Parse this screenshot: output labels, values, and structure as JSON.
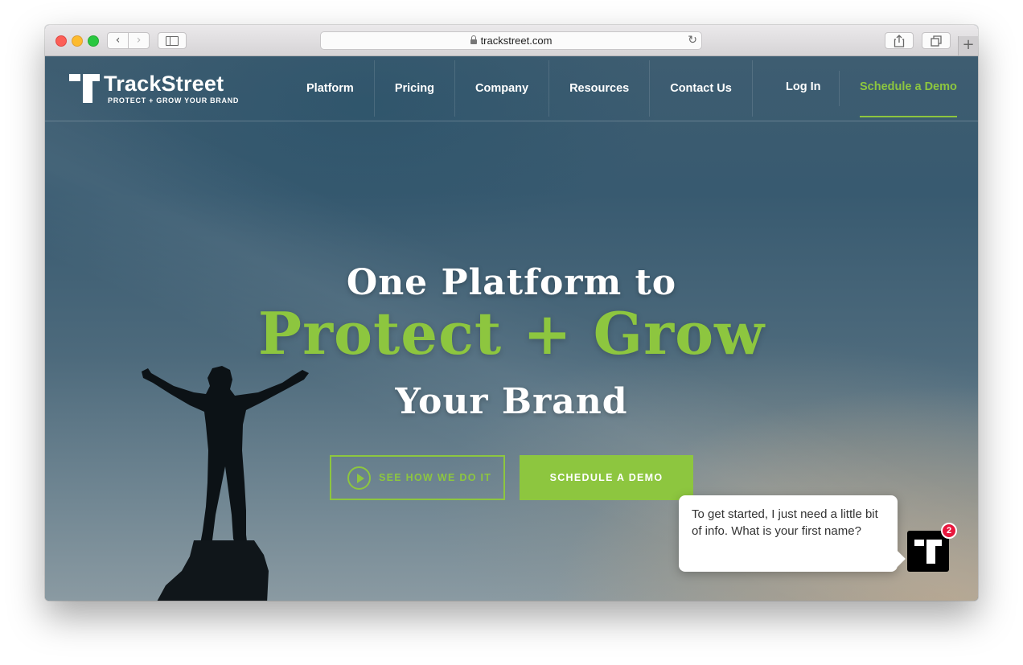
{
  "browser": {
    "url": "trackstreet.com",
    "nav_back": "‹",
    "nav_forward": "›",
    "reload": "↻",
    "new_tab": "+"
  },
  "site": {
    "logo": {
      "name": "TrackStreet",
      "tagline": "PROTECT + GROW YOUR BRAND"
    },
    "nav": {
      "items": [
        {
          "label": "Platform"
        },
        {
          "label": "Pricing"
        },
        {
          "label": "Company"
        },
        {
          "label": "Resources"
        },
        {
          "label": "Contact Us"
        }
      ],
      "login_label": "Log In",
      "demo_label": "Schedule a Demo"
    },
    "hero": {
      "line1": "One Platform to",
      "line2": "Protect + Grow",
      "line3": "Your Brand",
      "cta_secondary": "SEE HOW WE DO IT",
      "cta_primary": "SCHEDULE A DEMO"
    },
    "chat": {
      "message": "To get started, I just need a little bit of info. What is your first name?",
      "badge_count": "2"
    }
  },
  "colors": {
    "accent": "#8dc63f",
    "badge": "#e8173d",
    "sky": "#3e5d71"
  },
  "icons": [
    "back-icon",
    "forward-icon",
    "sidebar-icon",
    "lock-icon",
    "reload-icon",
    "share-icon",
    "tabs-icon",
    "plus-icon",
    "play-icon",
    "trackstreet-logo-icon"
  ]
}
